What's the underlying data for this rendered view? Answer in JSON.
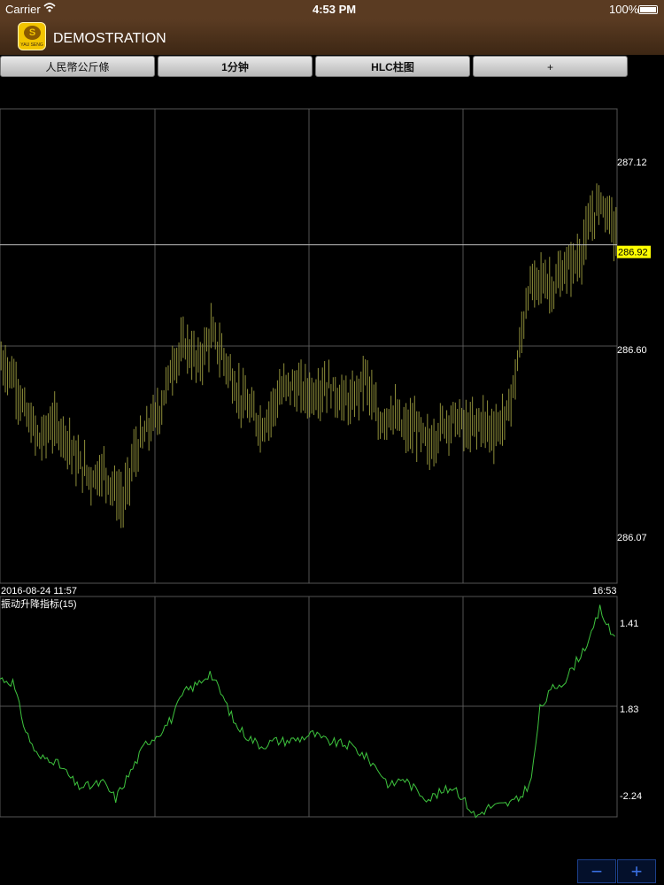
{
  "status_bar": {
    "carrier": "Carrier",
    "time": "4:53 PM",
    "battery": "100%"
  },
  "header": {
    "title": "DEMOSTRATION",
    "logo_text": "YAU SENG",
    "logo_glyph": "S"
  },
  "toolbar": {
    "buttons": [
      "人民幣公斤條",
      "1分钟",
      "HLC柱图",
      "+"
    ]
  },
  "colors": {
    "bars": "#8f8f3a",
    "indicator": "#3ec43e",
    "current_price_bg": "#ffff00",
    "grid": "#555555"
  },
  "chart_data": [
    {
      "type": "bar",
      "style": "HLC",
      "ylim": [
        285.9,
        287.33
      ],
      "y_ticks": [
        "287.12",
        "286.60",
        "286.07"
      ],
      "current_price": 286.92,
      "current_price_label": "286.92",
      "start_label": "2016-08-24 11:57",
      "end_label": "16:53",
      "anchors": [
        [
          0,
          286.57
        ],
        [
          6,
          286.52
        ],
        [
          12,
          286.4
        ],
        [
          18,
          286.33
        ],
        [
          24,
          286.38
        ],
        [
          30,
          286.35
        ],
        [
          36,
          286.26
        ],
        [
          42,
          286.22
        ],
        [
          48,
          286.24
        ],
        [
          54,
          286.17
        ],
        [
          57,
          286.14
        ],
        [
          62,
          286.28
        ],
        [
          68,
          286.36
        ],
        [
          74,
          286.42
        ],
        [
          80,
          286.56
        ],
        [
          86,
          286.62
        ],
        [
          92,
          286.56
        ],
        [
          98,
          286.65
        ],
        [
          104,
          286.58
        ],
        [
          110,
          286.48
        ],
        [
          116,
          286.42
        ],
        [
          122,
          286.37
        ],
        [
          128,
          286.45
        ],
        [
          134,
          286.5
        ],
        [
          140,
          286.48
        ],
        [
          146,
          286.47
        ],
        [
          152,
          286.5
        ],
        [
          158,
          286.46
        ],
        [
          164,
          286.44
        ],
        [
          170,
          286.53
        ],
        [
          176,
          286.38
        ],
        [
          182,
          286.42
        ],
        [
          188,
          286.36
        ],
        [
          194,
          286.37
        ],
        [
          200,
          286.31
        ],
        [
          206,
          286.38
        ],
        [
          212,
          286.4
        ],
        [
          218,
          286.36
        ],
        [
          224,
          286.39
        ],
        [
          230,
          286.36
        ],
        [
          236,
          286.4
        ],
        [
          240,
          286.52
        ],
        [
          246,
          286.78
        ],
        [
          252,
          286.82
        ],
        [
          258,
          286.79
        ],
        [
          264,
          286.85
        ],
        [
          270,
          286.88
        ],
        [
          276,
          287.0
        ],
        [
          280,
          287.06
        ],
        [
          285,
          286.99
        ],
        [
          287,
          286.95
        ]
      ]
    },
    {
      "type": "line",
      "title": "振动升降指标(15)",
      "y_ticks": [
        "1.41",
        "1.83",
        "-2.24"
      ],
      "y_tick_values": [
        1.41,
        1.83,
        -2.24
      ],
      "anchors": [
        [
          0,
          0.93
        ],
        [
          6,
          0.9
        ],
        [
          12,
          0.5
        ],
        [
          18,
          0.28
        ],
        [
          24,
          0.28
        ],
        [
          30,
          0.18
        ],
        [
          36,
          0.05
        ],
        [
          42,
          0.05
        ],
        [
          48,
          0.08
        ],
        [
          54,
          -0.05
        ],
        [
          58,
          0.08
        ],
        [
          62,
          0.2
        ],
        [
          68,
          0.4
        ],
        [
          74,
          0.48
        ],
        [
          80,
          0.6
        ],
        [
          86,
          0.82
        ],
        [
          92,
          0.88
        ],
        [
          98,
          0.98
        ],
        [
          104,
          0.78
        ],
        [
          110,
          0.55
        ],
        [
          116,
          0.45
        ],
        [
          122,
          0.38
        ],
        [
          128,
          0.42
        ],
        [
          134,
          0.42
        ],
        [
          140,
          0.44
        ],
        [
          146,
          0.48
        ],
        [
          152,
          0.42
        ],
        [
          158,
          0.4
        ],
        [
          164,
          0.38
        ],
        [
          170,
          0.3
        ],
        [
          176,
          0.2
        ],
        [
          182,
          0.05
        ],
        [
          188,
          0.12
        ],
        [
          194,
          0.02
        ],
        [
          200,
          -0.05
        ],
        [
          206,
          0.0
        ],
        [
          212,
          0.05
        ],
        [
          218,
          -0.1
        ],
        [
          222,
          -0.2
        ],
        [
          228,
          -0.12
        ],
        [
          236,
          -0.1
        ],
        [
          242,
          -0.06
        ],
        [
          248,
          0.1
        ],
        [
          252,
          0.68
        ],
        [
          258,
          0.85
        ],
        [
          264,
          0.92
        ],
        [
          270,
          1.1
        ],
        [
          276,
          1.28
        ],
        [
          280,
          1.5
        ],
        [
          285,
          1.3
        ],
        [
          287,
          1.28
        ]
      ]
    }
  ]
}
